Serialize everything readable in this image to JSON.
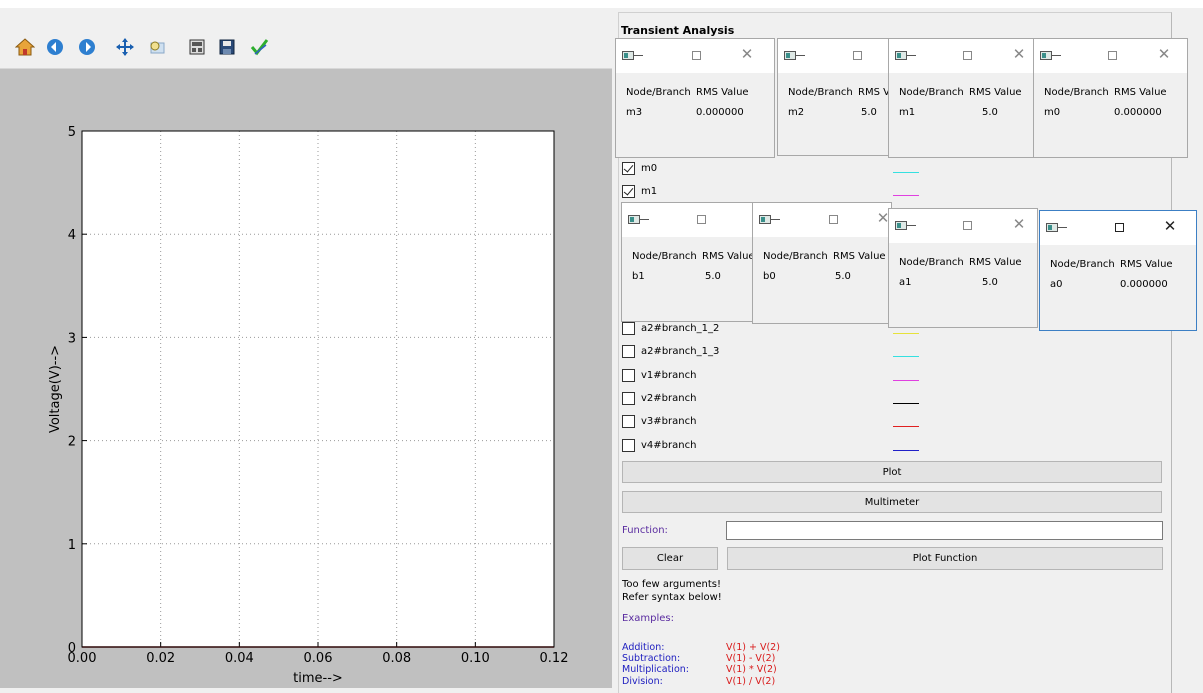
{
  "toolbar": {
    "buttons": [
      {
        "name": "home-icon",
        "label": "home"
      },
      {
        "name": "back-icon",
        "label": "back"
      },
      {
        "name": "forward-icon",
        "label": "forward"
      },
      {
        "name": "pan-icon",
        "label": "pan"
      },
      {
        "name": "zoom-icon",
        "label": "zoom"
      },
      {
        "name": "configure-subplots-icon",
        "label": "configure"
      },
      {
        "name": "save-icon",
        "label": "save"
      },
      {
        "name": "edit-icon",
        "label": "edit"
      }
    ]
  },
  "chart_data": {
    "type": "line",
    "title": "",
    "xlabel": "time-->",
    "ylabel": "Voltage(V)-->",
    "xlim": [
      0.0,
      0.12
    ],
    "ylim": [
      0,
      5
    ],
    "x_ticks": [
      "0.00",
      "0.02",
      "0.04",
      "0.06",
      "0.08",
      "0.10",
      "0.12"
    ],
    "y_ticks": [
      "0",
      "1",
      "2",
      "3",
      "4",
      "5"
    ],
    "grid": true,
    "series": [
      {
        "color": "#8b1a1a",
        "x": [
          0.0,
          0.12
        ],
        "y": [
          0,
          0
        ]
      }
    ]
  },
  "panel": {
    "title": "Transient Analysis",
    "checkboxes": [
      {
        "label": "m0",
        "checked": true,
        "color": "#35e0e0"
      },
      {
        "label": "m1",
        "checked": true,
        "color": "#e040e0"
      },
      {
        "label": "a2#branch_1_2",
        "checked": false,
        "color": "#e6e23a"
      },
      {
        "label": "a2#branch_1_3",
        "checked": false,
        "color": "#35e0e0"
      },
      {
        "label": "v1#branch",
        "checked": false,
        "color": "#e040e0"
      },
      {
        "label": "v2#branch",
        "checked": false,
        "color": "#000000"
      },
      {
        "label": "v3#branch",
        "checked": false,
        "color": "#e02020"
      },
      {
        "label": "v4#branch",
        "checked": false,
        "color": "#2020c8"
      }
    ],
    "plot_button": "Plot",
    "multimeter_button": "Multimeter",
    "function_label": "Function:",
    "function_value": "",
    "clear_button": "Clear",
    "plot_function_button": "Plot Function",
    "message_line1": "Too few arguments!",
    "message_line2": "Refer syntax below!",
    "examples_title": "Examples:",
    "examples": [
      {
        "name": "Addition:",
        "expr": "V(1) + V(2)"
      },
      {
        "name": "Subtraction:",
        "expr": "V(1) - V(2)"
      },
      {
        "name": "Multiplication:",
        "expr": "V(1) * V(2)"
      },
      {
        "name": "Division:",
        "expr": "V(1) / V(2)"
      }
    ]
  },
  "multimeters": [
    {
      "node": "m3",
      "value": "0.000000",
      "header_node": "Node/Branch",
      "header_value": "RMS Value"
    },
    {
      "node": "m2",
      "value": "5.0",
      "header_node": "Node/Branch",
      "header_value": "RMS V"
    },
    {
      "node": "m1",
      "value": "5.0",
      "header_node": "Node/Branch",
      "header_value": "RMS Value"
    },
    {
      "node": "m0",
      "value": "0.000000",
      "header_node": "Node/Branch",
      "header_value": "RMS Value"
    },
    {
      "node": "b1",
      "value": "5.0",
      "header_node": "Node/Branch",
      "header_value": "RMS Value"
    },
    {
      "node": "b0",
      "value": "5.0",
      "header_node": "Node/Branch",
      "header_value": "RMS Value"
    },
    {
      "node": "a1",
      "value": "5.0",
      "header_node": "Node/Branch",
      "header_value": "RMS Value"
    },
    {
      "node": "a0",
      "value": "0.000000",
      "header_node": "Node/Branch",
      "header_value": "RMS Value"
    }
  ]
}
